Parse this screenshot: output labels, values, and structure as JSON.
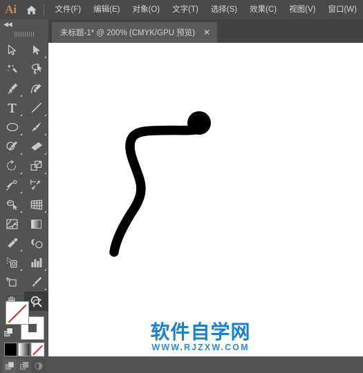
{
  "app": {
    "name": "Ai",
    "logo_color": "#c38b5f",
    "home_icon": "home-icon"
  },
  "menu": {
    "items": [
      {
        "label": "文件(F)",
        "name": "menu-file"
      },
      {
        "label": "编辑(E)",
        "name": "menu-edit"
      },
      {
        "label": "对象(O)",
        "name": "menu-object"
      },
      {
        "label": "文字(T)",
        "name": "menu-type"
      },
      {
        "label": "选择(S)",
        "name": "menu-select"
      },
      {
        "label": "效果(C)",
        "name": "menu-effect"
      },
      {
        "label": "视图(V)",
        "name": "menu-view"
      },
      {
        "label": "窗口(W)",
        "name": "menu-window"
      }
    ]
  },
  "tab": {
    "title": "未标题-1* @ 200% (CMYK/GPU 预览)",
    "close_label": "✕",
    "document_name": "未标题-1",
    "modified": true,
    "zoom_level": "200%",
    "color_mode": "CMYK",
    "preview_mode": "GPU 预览"
  },
  "toolpanel": {
    "collapse_label": "◀◀",
    "grip": "drag-handle",
    "tools": [
      {
        "name": "selection-tool",
        "label": "选择工具",
        "has_flyout": false,
        "selected": false
      },
      {
        "name": "direct-selection-tool",
        "label": "直接选择工具",
        "has_flyout": true,
        "selected": false
      },
      {
        "name": "magic-wand-tool",
        "label": "魔棒工具",
        "has_flyout": false,
        "selected": false
      },
      {
        "name": "lasso-tool",
        "label": "套索工具",
        "has_flyout": false,
        "selected": false
      },
      {
        "name": "pen-tool",
        "label": "钢笔工具",
        "has_flyout": true,
        "selected": false
      },
      {
        "name": "curvature-tool",
        "label": "曲率工具",
        "has_flyout": false,
        "selected": false
      },
      {
        "name": "type-tool",
        "label": "文字工具",
        "has_flyout": true,
        "selected": false
      },
      {
        "name": "line-segment-tool",
        "label": "直线段工具",
        "has_flyout": true,
        "selected": false
      },
      {
        "name": "ellipse-tool",
        "label": "椭圆工具",
        "has_flyout": true,
        "selected": false
      },
      {
        "name": "paintbrush-tool",
        "label": "画笔工具",
        "has_flyout": true,
        "selected": false
      },
      {
        "name": "shaper-tool",
        "label": "Shaper 工具",
        "has_flyout": true,
        "selected": false
      },
      {
        "name": "eraser-tool",
        "label": "橡皮擦工具",
        "has_flyout": true,
        "selected": false
      },
      {
        "name": "rotate-tool",
        "label": "旋转工具",
        "has_flyout": true,
        "selected": false
      },
      {
        "name": "scale-tool",
        "label": "比例缩放工具",
        "has_flyout": true,
        "selected": false
      },
      {
        "name": "width-tool",
        "label": "宽度工具",
        "has_flyout": true,
        "selected": false
      },
      {
        "name": "free-transform-tool",
        "label": "自由变换工具",
        "has_flyout": false,
        "selected": false
      },
      {
        "name": "shape-builder-tool",
        "label": "形状生成器工具",
        "has_flyout": true,
        "selected": false
      },
      {
        "name": "perspective-grid-tool",
        "label": "透视网格工具",
        "has_flyout": true,
        "selected": false
      },
      {
        "name": "mesh-tool",
        "label": "网格工具",
        "has_flyout": false,
        "selected": false
      },
      {
        "name": "gradient-tool",
        "label": "渐变工具",
        "has_flyout": false,
        "selected": false
      },
      {
        "name": "eyedropper-tool",
        "label": "吸管工具",
        "has_flyout": true,
        "selected": false
      },
      {
        "name": "blend-tool",
        "label": "混合工具",
        "has_flyout": false,
        "selected": false
      },
      {
        "name": "symbol-sprayer-tool",
        "label": "符号喷枪工具",
        "has_flyout": true,
        "selected": false
      },
      {
        "name": "column-graph-tool",
        "label": "柱形图工具",
        "has_flyout": true,
        "selected": false
      },
      {
        "name": "artboard-tool",
        "label": "画板工具",
        "has_flyout": false,
        "selected": false
      },
      {
        "name": "slice-tool",
        "label": "切片工具",
        "has_flyout": true,
        "selected": false
      },
      {
        "name": "hand-tool",
        "label": "抓手工具",
        "has_flyout": true,
        "selected": false
      },
      {
        "name": "zoom-tool",
        "label": "缩放工具",
        "has_flyout": false,
        "selected": true
      }
    ],
    "fill_stroke": {
      "fill": "none",
      "fill_color": "#ffffff",
      "stroke": "white",
      "stroke_color": "#ffffff",
      "swap_icon": "swap-fill-stroke-icon",
      "default_icon": "default-fill-stroke-icon"
    },
    "color_modes": [
      {
        "name": "color-swatch",
        "label": "颜色",
        "color": "#000000",
        "selected": false
      },
      {
        "name": "gradient-swatch",
        "label": "渐变",
        "color": "gradient",
        "selected": false
      },
      {
        "name": "none-swatch",
        "label": "无",
        "color": "none",
        "selected": true
      }
    ],
    "draw_modes": [
      {
        "name": "draw-normal-mode",
        "label": "正常绘图",
        "selected": true
      },
      {
        "name": "draw-behind-mode",
        "label": "背面绘图",
        "selected": false
      },
      {
        "name": "draw-inside-mode",
        "label": "内部绘图",
        "selected": false
      }
    ]
  },
  "canvas": {
    "name": "artboard-canvas",
    "background": "#ffffff",
    "artwork": {
      "name": "brush-stroke-path",
      "description": "黑色画笔描边 S 形曲线，末端为圆形墨点",
      "fill_color": "#000000"
    }
  },
  "watermark": {
    "chinese": "软件自学网",
    "url": "WWW.RJZXW.COM",
    "color": "#1b7fd4"
  }
}
